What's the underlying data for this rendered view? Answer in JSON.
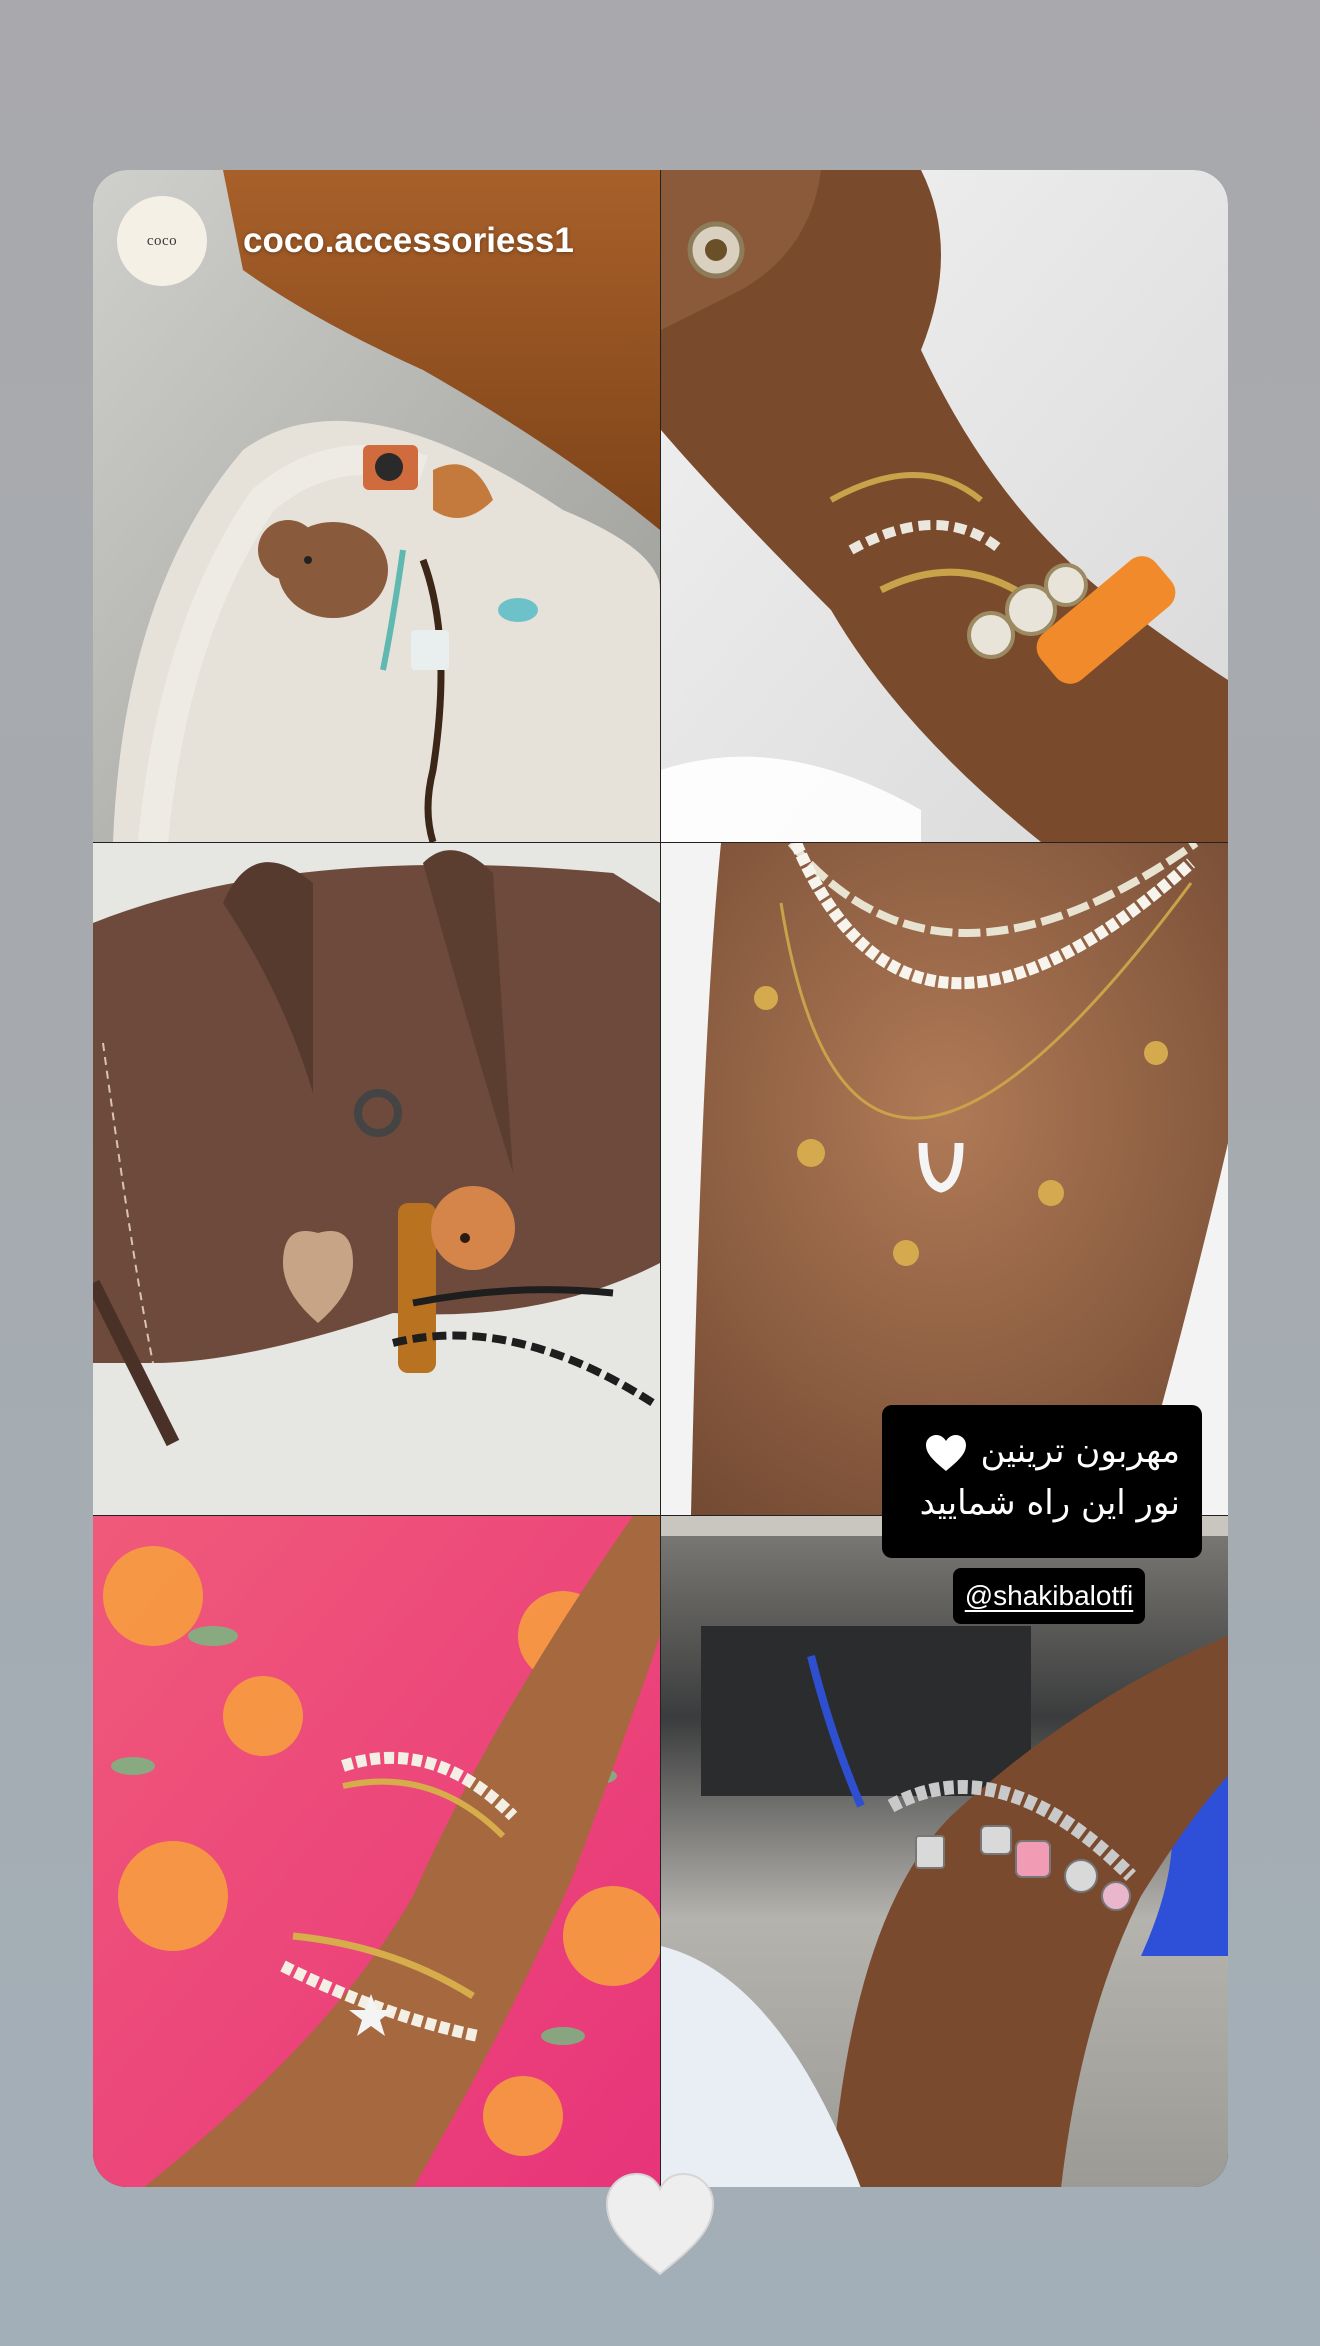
{
  "story": {
    "account": {
      "avatar_text": "coco",
      "username": "coco.accessoriess1"
    },
    "caption": {
      "line1": "مهربون ترینین",
      "line2": "نور این راه شمایید",
      "emoji": "white-heart-icon"
    },
    "mention": "@shakibalotfi",
    "tiles": [
      {
        "subject": "keychain-bear-camera-croissant"
      },
      {
        "subject": "stacked-bracelets-orange-bangle"
      },
      {
        "subject": "brown-bag-with-heart-and-bear-keychains"
      },
      {
        "subject": "layered-pearl-gold-necklaces"
      },
      {
        "subject": "gold-pearl-bracelets-pink-floral"
      },
      {
        "subject": "silver-charm-bracelet"
      }
    ],
    "like_icon": "heart-icon"
  },
  "colors": {
    "background_top": "#a9a9ad",
    "background_bottom": "#a3afb8",
    "caption_bg": "#000000",
    "caption_text": "#ffffff",
    "like_heart": "#eeeeee"
  }
}
